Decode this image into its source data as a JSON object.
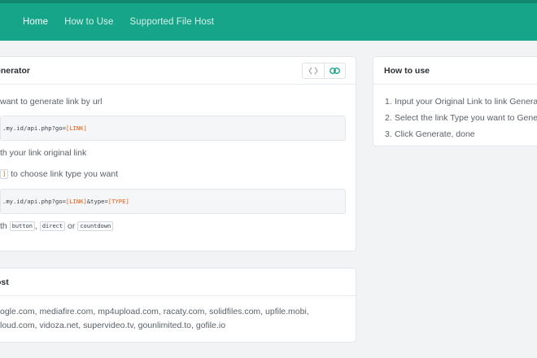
{
  "nav": {
    "items": [
      {
        "label": "Home",
        "active": true
      },
      {
        "label": "How to Use",
        "active": false
      },
      {
        "label": "Supported File Host",
        "active": false
      }
    ]
  },
  "generator": {
    "title": "enerator",
    "line1": "want to generate link by url",
    "code1_prefix": ".my.id/api.php?go=",
    "code1_token": "[LINK]",
    "line2": "th your link original link",
    "line3_token": "]",
    "line3_rest": "to choose link type you want",
    "code2_prefix": ".my.id/api.php?go=",
    "code2_token1": "[LINK]",
    "code2_mid": "&type=",
    "code2_token2": "[TYPE]",
    "line4_prefix": "th",
    "types": [
      "button",
      "direct",
      "countdown"
    ],
    "sep_comma": ",",
    "sep_or": "or",
    "toolbar_icons": [
      "code-icon",
      "link-icon"
    ]
  },
  "howto": {
    "title": "How to use",
    "steps": [
      {
        "num": "1.",
        "text": "Input your Original Link to link Genera"
      },
      {
        "num": "2.",
        "text": "Select the link Type you want to Gene"
      },
      {
        "num": "3.",
        "text": "Click Generate, done"
      }
    ]
  },
  "hosts": {
    "title": "ost",
    "line1": "ogle.com, mediafire.com, mp4upload.com, racaty.com, solidfiles.com, upfile.mobi,",
    "line2": "loud.com, vidoza.net, supervideo.tv, gounlimited.to, gofile.io"
  },
  "colors": {
    "brand": "#17a589",
    "accent_token": "#e8590c"
  }
}
